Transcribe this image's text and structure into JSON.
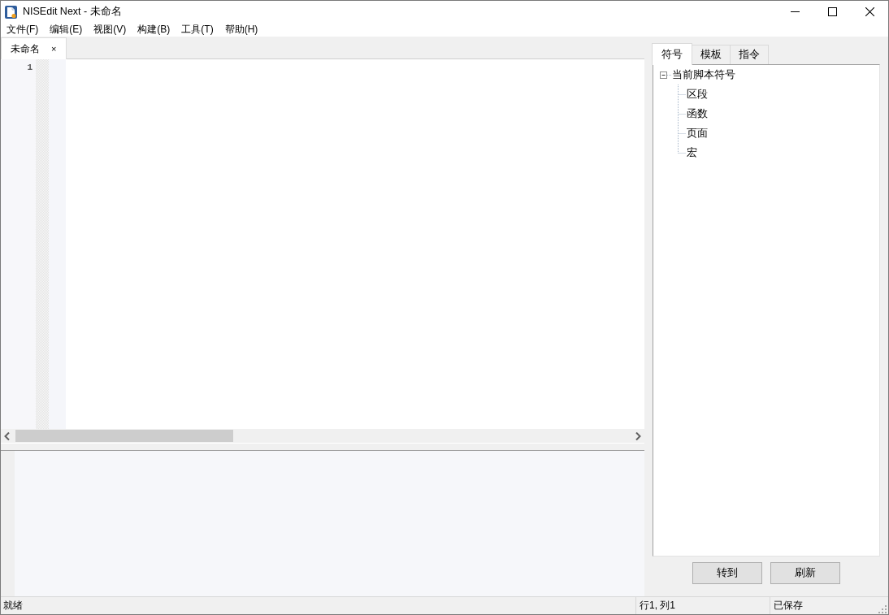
{
  "window": {
    "title": "NISEdit Next - 未命名"
  },
  "menu": [
    "文件(F)",
    "编辑(E)",
    "视图(V)",
    "构建(B)",
    "工具(T)",
    "帮助(H)"
  ],
  "editor_tabs": [
    {
      "label": "未命名",
      "selected": true,
      "close": "×"
    }
  ],
  "editor": {
    "line_numbers": [
      "1"
    ]
  },
  "side_tabs": [
    {
      "label": "符号",
      "selected": true
    },
    {
      "label": "模板",
      "selected": false
    },
    {
      "label": "指令",
      "selected": false
    }
  ],
  "symbol_tree": [
    {
      "label": "当前脚本符号",
      "expanded": true,
      "children": [
        {
          "label": "区段"
        },
        {
          "label": "函数"
        },
        {
          "label": "页面"
        },
        {
          "label": "宏"
        }
      ]
    }
  ],
  "buttons": [
    "转到",
    "刷新"
  ],
  "status_bar": {
    "message": "就绪",
    "position": "行1, 列1",
    "save_state": "已保存"
  }
}
